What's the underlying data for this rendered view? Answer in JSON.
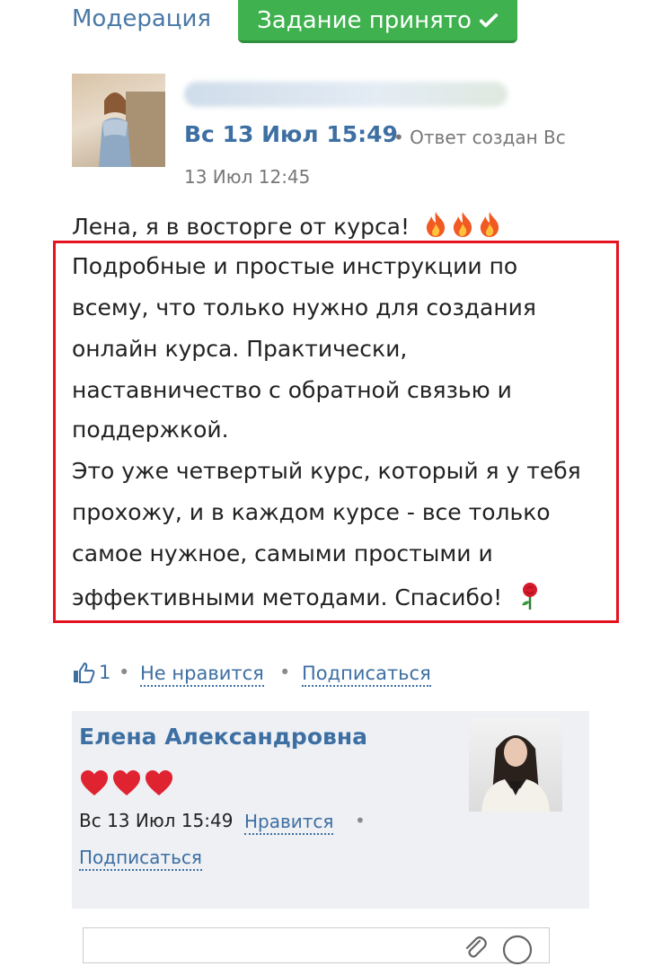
{
  "header": {
    "moderation_label": "Модерация",
    "accepted_label": "Задание принято"
  },
  "post": {
    "date": "Вс 13 Июл 15:49",
    "created_label": "• Ответ создан Вс",
    "created_time": "13 Июл 12:45",
    "intro": "Лена, я в восторге от курса!",
    "lines": [
      "Подробные и простые инструкции по",
      "всему, что только нужно для создания",
      "онлайн курса. Практически,",
      "наставничество с обратной связью и",
      "поддержкой.",
      "Это уже четвертый курс, который я у тебя",
      "прохожу, и в каждом курсе - все только",
      "самое нужное, самыми простыми и",
      "эффективными методами.  Спасибо!"
    ]
  },
  "actions": {
    "like_count": "1",
    "dislike_label": "Не нравится",
    "subscribe_label": "Подписаться"
  },
  "reply": {
    "author": "Елена Александровна",
    "date": "Вс 13 Июл 15:49",
    "like_label": "Нравится",
    "subscribe_label": "Подписаться"
  },
  "colors": {
    "link": "#3d6fa3",
    "accept_green": "#3fb24f",
    "highlight_red": "#e5121f",
    "reply_bg": "#eef0f4"
  },
  "icons": [
    "check-icon",
    "fire-icon",
    "rose-icon",
    "thumb-up-icon",
    "heart-icon",
    "paperclip-icon",
    "smile-icon"
  ]
}
